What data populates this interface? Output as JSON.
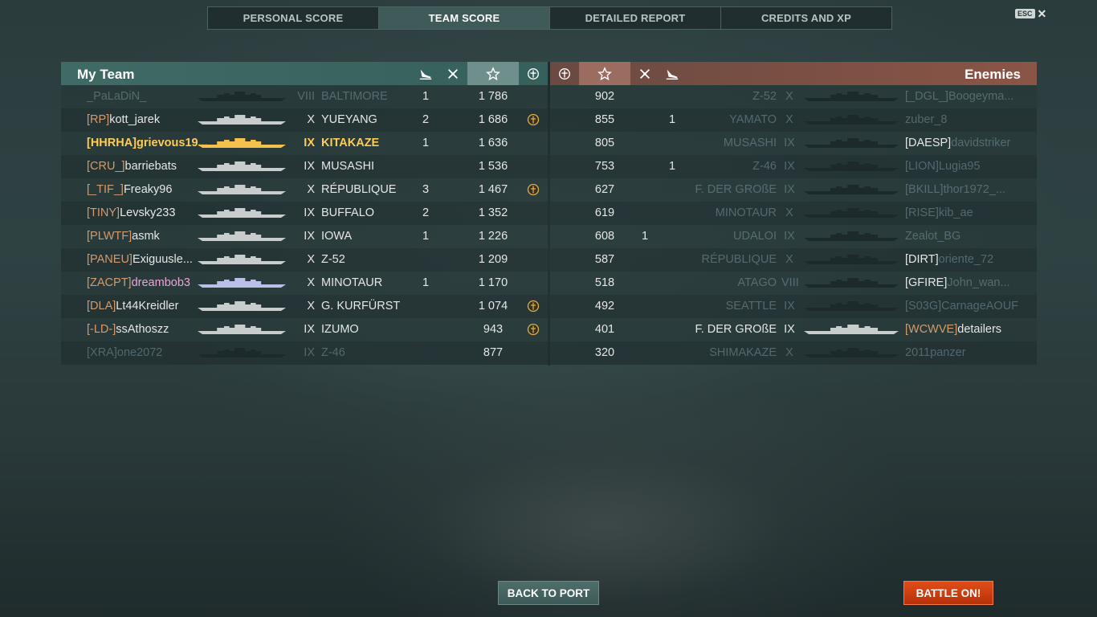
{
  "tabs": [
    "PERSONAL SCORE",
    "TEAM SCORE",
    "DETAILED REPORT",
    "CREDITS AND XP"
  ],
  "active_tab": 1,
  "esc_label": "ESC",
  "my_team": {
    "title": "My Team",
    "columns": [
      "planes-icon",
      "kills-icon",
      "star-icon",
      "medal-icon"
    ],
    "rows": [
      {
        "clan": "",
        "name": "_PaLaDiN_",
        "tier": "VIII",
        "ship": "BALTIMORE",
        "kills": "1",
        "score": "1 786",
        "medal": false,
        "dim": true
      },
      {
        "clan": "[RP]",
        "name": "kott_jarek",
        "tier": "X",
        "ship": "YUEYANG",
        "kills": "2",
        "score": "1 686",
        "medal": true
      },
      {
        "clan": "[HHRHA]",
        "name": "grievous19...",
        "tier": "IX",
        "ship": "KITAKAZE",
        "kills": "1",
        "score": "1 636",
        "medal": false,
        "self": true
      },
      {
        "clan": "[CRU_]",
        "name": "barriebats",
        "tier": "IX",
        "ship": "MUSASHI",
        "kills": "",
        "score": "1 536",
        "medal": false
      },
      {
        "clan": "[_TIF_]",
        "name": "Freaky96",
        "tier": "X",
        "ship": "RÉPUBLIQUE",
        "kills": "3",
        "score": "1 467",
        "medal": true
      },
      {
        "clan": "[TINY]",
        "name": "Levsky233",
        "tier": "IX",
        "ship": "BUFFALO",
        "kills": "2",
        "score": "1 352",
        "medal": false
      },
      {
        "clan": "[PLWTF]",
        "name": "asmk",
        "tier": "IX",
        "ship": "IOWA",
        "kills": "1",
        "score": "1 226",
        "medal": false
      },
      {
        "clan": "[PANEU]",
        "name": "Exiguusle...",
        "tier": "X",
        "ship": "Z-52",
        "kills": "",
        "score": "1 209",
        "medal": false
      },
      {
        "clan": "[ZACPT]",
        "name": "dreambob3",
        "tier": "X",
        "ship": "MINOTAUR",
        "kills": "1",
        "score": "1 170",
        "medal": false,
        "pink": true
      },
      {
        "clan": "[DLA]",
        "name": "Lt44Kreidler",
        "tier": "X",
        "ship": "G. KURFÜRST",
        "kills": "",
        "score": "1 074",
        "medal": true
      },
      {
        "clan": "[-LD-]",
        "name": "ssAthoszz",
        "tier": "IX",
        "ship": "IZUMO",
        "kills": "",
        "score": "943",
        "medal": true
      },
      {
        "clan": "[XRA]",
        "name": "one2072",
        "tier": "IX",
        "ship": "Z-46",
        "kills": "",
        "score": "877",
        "medal": false,
        "dim": true
      }
    ]
  },
  "enemies": {
    "title": "Enemies",
    "columns": [
      "medal-icon",
      "star-icon",
      "kills-icon",
      "planes-icon"
    ],
    "rows": [
      {
        "score": "902",
        "kills": "",
        "planes": "",
        "ship": "Z-52",
        "tier": "X",
        "clan": "[_DGL_]",
        "name": "Boogeyma...",
        "dim": true
      },
      {
        "score": "855",
        "kills": "1",
        "planes": "",
        "ship": "YAMATO",
        "tier": "X",
        "clan": "",
        "name": "zuber_8",
        "dim": true
      },
      {
        "score": "805",
        "kills": "",
        "planes": "",
        "ship": "MUSASHI",
        "tier": "IX",
        "clan": "[DAESP]",
        "name": "davidstriker",
        "dim": true,
        "clan_white": true
      },
      {
        "score": "753",
        "kills": "1",
        "planes": "",
        "ship": "Z-46",
        "tier": "IX",
        "clan": "[LION]",
        "name": "Lugia95",
        "dim": true
      },
      {
        "score": "627",
        "kills": "",
        "planes": "",
        "ship": "F. DER GROßE",
        "tier": "IX",
        "clan": "[BKILL]",
        "name": "thor1972_...",
        "dim": true
      },
      {
        "score": "619",
        "kills": "",
        "planes": "",
        "ship": "MINOTAUR",
        "tier": "X",
        "clan": "[RISE]",
        "name": "kib_ae",
        "dim": true
      },
      {
        "score": "608",
        "kills": "",
        "planes": "1",
        "ship": "UDALOI",
        "tier": "IX",
        "clan": "",
        "name": "Zealot_BG",
        "dim": true
      },
      {
        "score": "587",
        "kills": "",
        "planes": "",
        "ship": "RÉPUBLIQUE",
        "tier": "X",
        "clan": "[DIRT]",
        "name": "oriente_72",
        "dim": true,
        "clan_white": true
      },
      {
        "score": "518",
        "kills": "",
        "planes": "",
        "ship": "ATAGO",
        "tier": "VIII",
        "clan": "[GFIRE]",
        "name": "John_wan...",
        "dim": true,
        "clan_white": true
      },
      {
        "score": "492",
        "kills": "",
        "planes": "",
        "ship": "SEATTLE",
        "tier": "IX",
        "clan": "[S03G]",
        "name": "CarnageAOUF",
        "dim": true
      },
      {
        "score": "401",
        "kills": "",
        "planes": "",
        "ship": "F. DER GROßE",
        "tier": "IX",
        "clan": "[WCWVE]",
        "name": "detailers",
        "dim": false
      },
      {
        "score": "320",
        "kills": "",
        "planes": "",
        "ship": "SHIMAKAZE",
        "tier": "X",
        "clan": "",
        "name": "2011panzer",
        "dim": true
      }
    ]
  },
  "buttons": {
    "back": "BACK TO PORT",
    "battle": "BATTLE ON!"
  },
  "colors": {
    "clan": "#d29b6e",
    "self": "#ffcc55",
    "battle": "#d0400f",
    "ally_header": "#3f6a66",
    "enemy_header": "#8a5546"
  }
}
